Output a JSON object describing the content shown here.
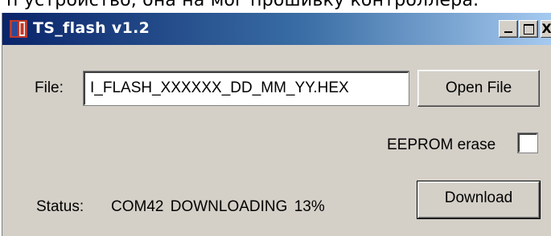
{
  "background_text": "п устройство, она на мог прошивку контроллера.",
  "window": {
    "title": "TS_flash  v1.2",
    "buttons": {
      "minimize_icon": "minimize-icon",
      "maximize_icon": "maximize-icon",
      "close_label": "X"
    }
  },
  "form": {
    "file_label": "File:",
    "file_value": "I_FLASH_XXXXXX_DD_MM_YY.HEX",
    "open_file_label": "Open File",
    "eeprom_label": "EEPROM erase",
    "eeprom_checked": false,
    "status_label": "Status:",
    "status_text": "COM42  DOWNLOADING  13%",
    "download_label": "Download"
  },
  "colors": {
    "titlebar_start": "#0a246a",
    "titlebar_end": "#a6caf0",
    "window_face": "#d4d0c8",
    "icon_red": "#c0392b",
    "icon_blue": "#2a4a9a"
  }
}
